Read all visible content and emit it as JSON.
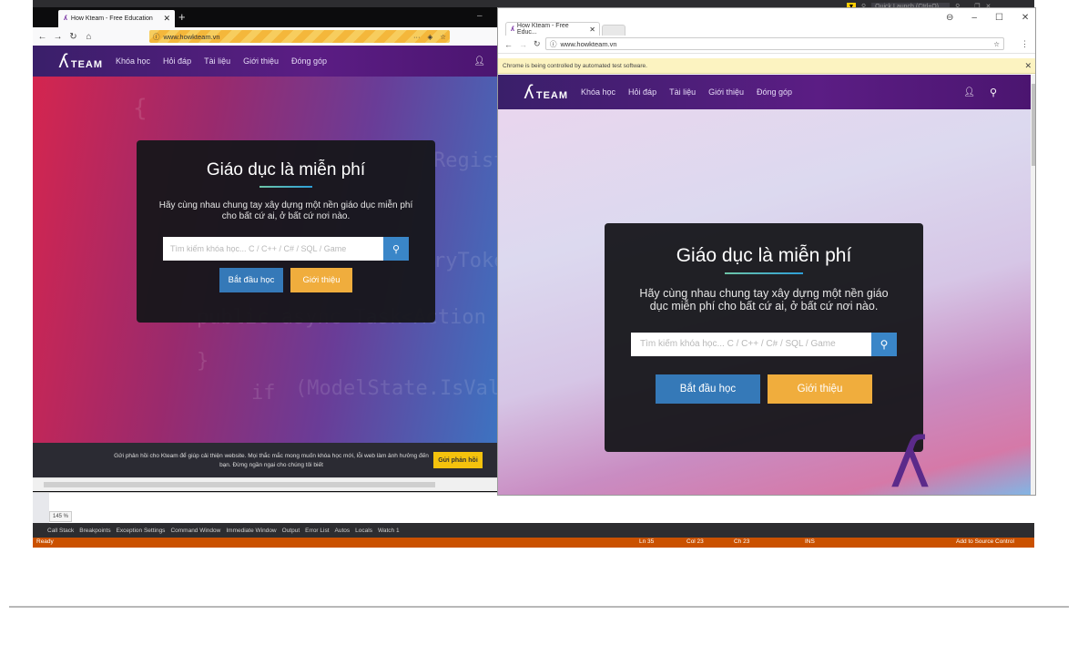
{
  "vs": {
    "quick_launch": "Quick Launch (Ctrl+Q)",
    "zoom": "145 %",
    "tool_tabs": [
      "Call Stack",
      "Breakpoints",
      "Exception Settings",
      "Command Window",
      "Immediate Window",
      "Output",
      "Error List",
      "Autos",
      "Locals",
      "Watch 1"
    ],
    "status": {
      "ready": "Ready",
      "ln": "Ln 35",
      "col": "Col 23",
      "ch": "Ch 23",
      "ins": "INS",
      "source_control": "Add to Source Control"
    }
  },
  "firefox": {
    "tab_title": "How Kteam - Free Education",
    "url": "www.howkteam.vn",
    "site": {
      "logo": "TEAM",
      "nav": [
        "Khóa học",
        "Hỏi đáp",
        "Tài liệu",
        "Giới thiệu",
        "Đóng góp"
      ],
      "hero_title": "Giáo dục là miễn phí",
      "hero_sub": "Hãy cùng nhau chung tay xây dựng một nền giáo dục miễn phí cho bất cứ ai, ở bất cứ nơi nào.",
      "search_placeholder": "Tìm kiếm khóa học... C / C++ / C# / SQL / Game",
      "btn_start": "Bắt đầu học",
      "btn_intro": "Giới thiệu",
      "feedback_text": "Gửi phản hồi cho Kteam để giúp cải thiện website. Mọi thắc mắc mong muốn khóa học mới, lỗi web làm ảnh hưởng đến bạn. Đừng ngần ngại cho chúng tôi biết",
      "feedback_btn": "Gửi phản hồi"
    },
    "code_ghost": [
      "Regist",
      "ryToke",
      "public async Task<Action",
      "(ModelState.IsVal",
      "if",
      "{",
      "}"
    ]
  },
  "chrome": {
    "tab_title": "How Kteam - Free Educ...",
    "url": "www.howkteam.vn",
    "infobar": "Chrome is being controlled by automated test software.",
    "site": {
      "logo": "TEAM",
      "nav": [
        "Khóa học",
        "Hỏi đáp",
        "Tài liệu",
        "Giới thiệu",
        "Đóng góp"
      ],
      "hero_title": "Giáo dục là miễn phí",
      "hero_sub": "Hãy cùng nhau chung tay xây dựng một nền giáo dục miễn phí cho bất cứ ai, ở bất cứ nơi nào.",
      "search_placeholder": "Tìm kiếm khóa học... C / C++ / C# / SQL / Game",
      "btn_start": "Bắt đầu học",
      "btn_intro": "Giới thiệu"
    }
  },
  "colors": {
    "purple_nav": "#5b1d84",
    "blue_btn": "#3579b8",
    "orange_btn": "#f0ad3d",
    "vs_status": "#ca5100"
  },
  "icons": [
    "search-icon",
    "user-icon",
    "close-icon",
    "back-icon",
    "forward-icon",
    "reload-icon",
    "home-icon",
    "star-icon",
    "menu-icon",
    "lock-icon",
    "info-icon"
  ]
}
